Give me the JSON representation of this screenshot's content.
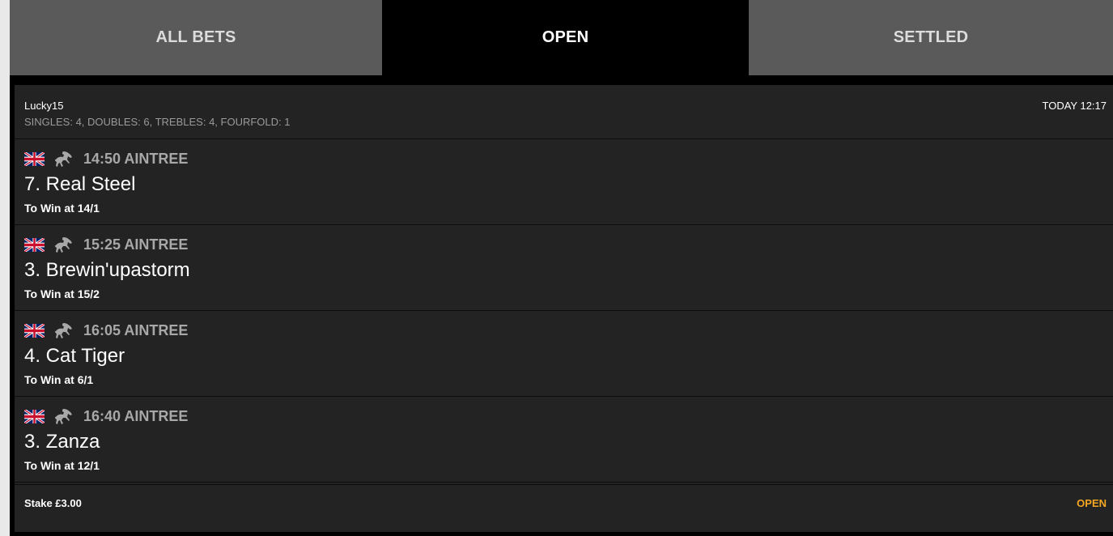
{
  "tabs": [
    {
      "label": "ALL BETS"
    },
    {
      "label": "OPEN"
    },
    {
      "label": "SETTLED"
    }
  ],
  "bet": {
    "type": "Lucky15",
    "breakdown": "SINGLES: 4, DOUBLES: 6, TREBLES: 4, FOURFOLD: 1",
    "time": "TODAY 12:17",
    "selections": [
      {
        "race": "14:50 AINTREE",
        "runner": "7. Real Steel",
        "odds": "To Win at 14/1",
        "flag_icon": "uk-flag-icon",
        "sport_icon": "horse-racing-icon"
      },
      {
        "race": "15:25 AINTREE",
        "runner": "3. Brewin'upastorm",
        "odds": "To Win at 15/2",
        "flag_icon": "uk-flag-icon",
        "sport_icon": "horse-racing-icon"
      },
      {
        "race": "16:05 AINTREE",
        "runner": "4. Cat Tiger",
        "odds": "To Win at 6/1",
        "flag_icon": "uk-flag-icon",
        "sport_icon": "horse-racing-icon"
      },
      {
        "race": "16:40 AINTREE",
        "runner": "3. Zanza",
        "odds": "To Win at 12/1",
        "flag_icon": "uk-flag-icon",
        "sport_icon": "horse-racing-icon"
      }
    ],
    "stake": "Stake £3.00",
    "status": "OPEN",
    "status_color": "#f5a623"
  }
}
